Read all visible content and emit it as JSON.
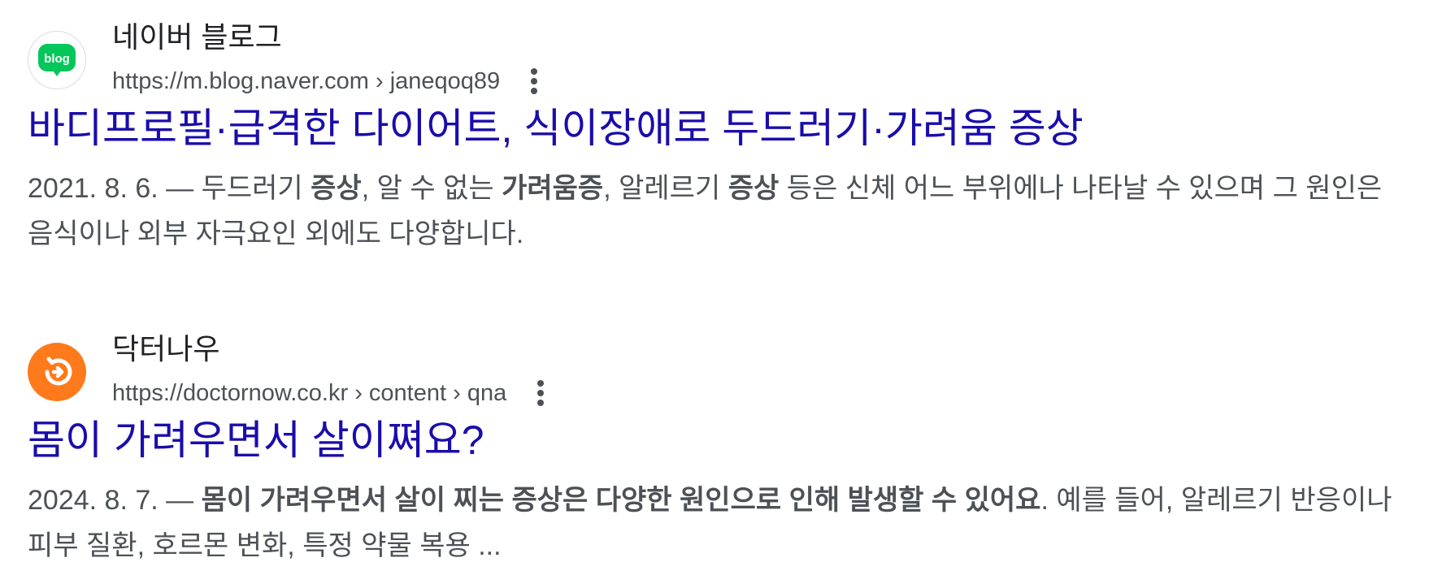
{
  "results": [
    {
      "site_name": "네이버 블로그",
      "url": "https://m.blog.naver.com › janeqoq89",
      "title": "바디프로필·급격한 다이어트, 식이장애로 두드러기·가려움 증상",
      "favicon": {
        "icon": "naver-blog-icon",
        "text": "blog",
        "color": "#03c75a"
      },
      "snippet": {
        "date": "2021. 8. 6.",
        "dash": " — ",
        "parts": [
          {
            "text": "두드러기 ",
            "bold": false
          },
          {
            "text": "증상",
            "bold": true
          },
          {
            "text": ", 알 수 없는 ",
            "bold": false
          },
          {
            "text": "가려움증",
            "bold": true
          },
          {
            "text": ", 알레르기 ",
            "bold": false
          },
          {
            "text": "증상",
            "bold": true
          },
          {
            "text": " 등은 신체 어느 부위에나 나타날 수 있으며 그 원인은 음식이나 외부 자극요인 외에도 다양합니다.",
            "bold": false
          }
        ]
      }
    },
    {
      "site_name": "닥터나우",
      "url": "https://doctornow.co.kr › content › qna",
      "title": "몸이 가려우면서 살이쪄요?",
      "favicon": {
        "icon": "doctornow-icon",
        "text": "",
        "color": "#ff7a1a"
      },
      "snippet": {
        "date": "2024. 8. 7.",
        "dash": " — ",
        "parts": [
          {
            "text": "몸이 가려우면서 살이 찌는 증상은 다양한 원인으로 인해 발생할 수 있어요",
            "bold": true
          },
          {
            "text": ". 예를 들어, 알레르기 반응이나 피부 질환, 호르몬 변화, 특정 약물 복용 ...",
            "bold": false
          }
        ]
      }
    }
  ]
}
